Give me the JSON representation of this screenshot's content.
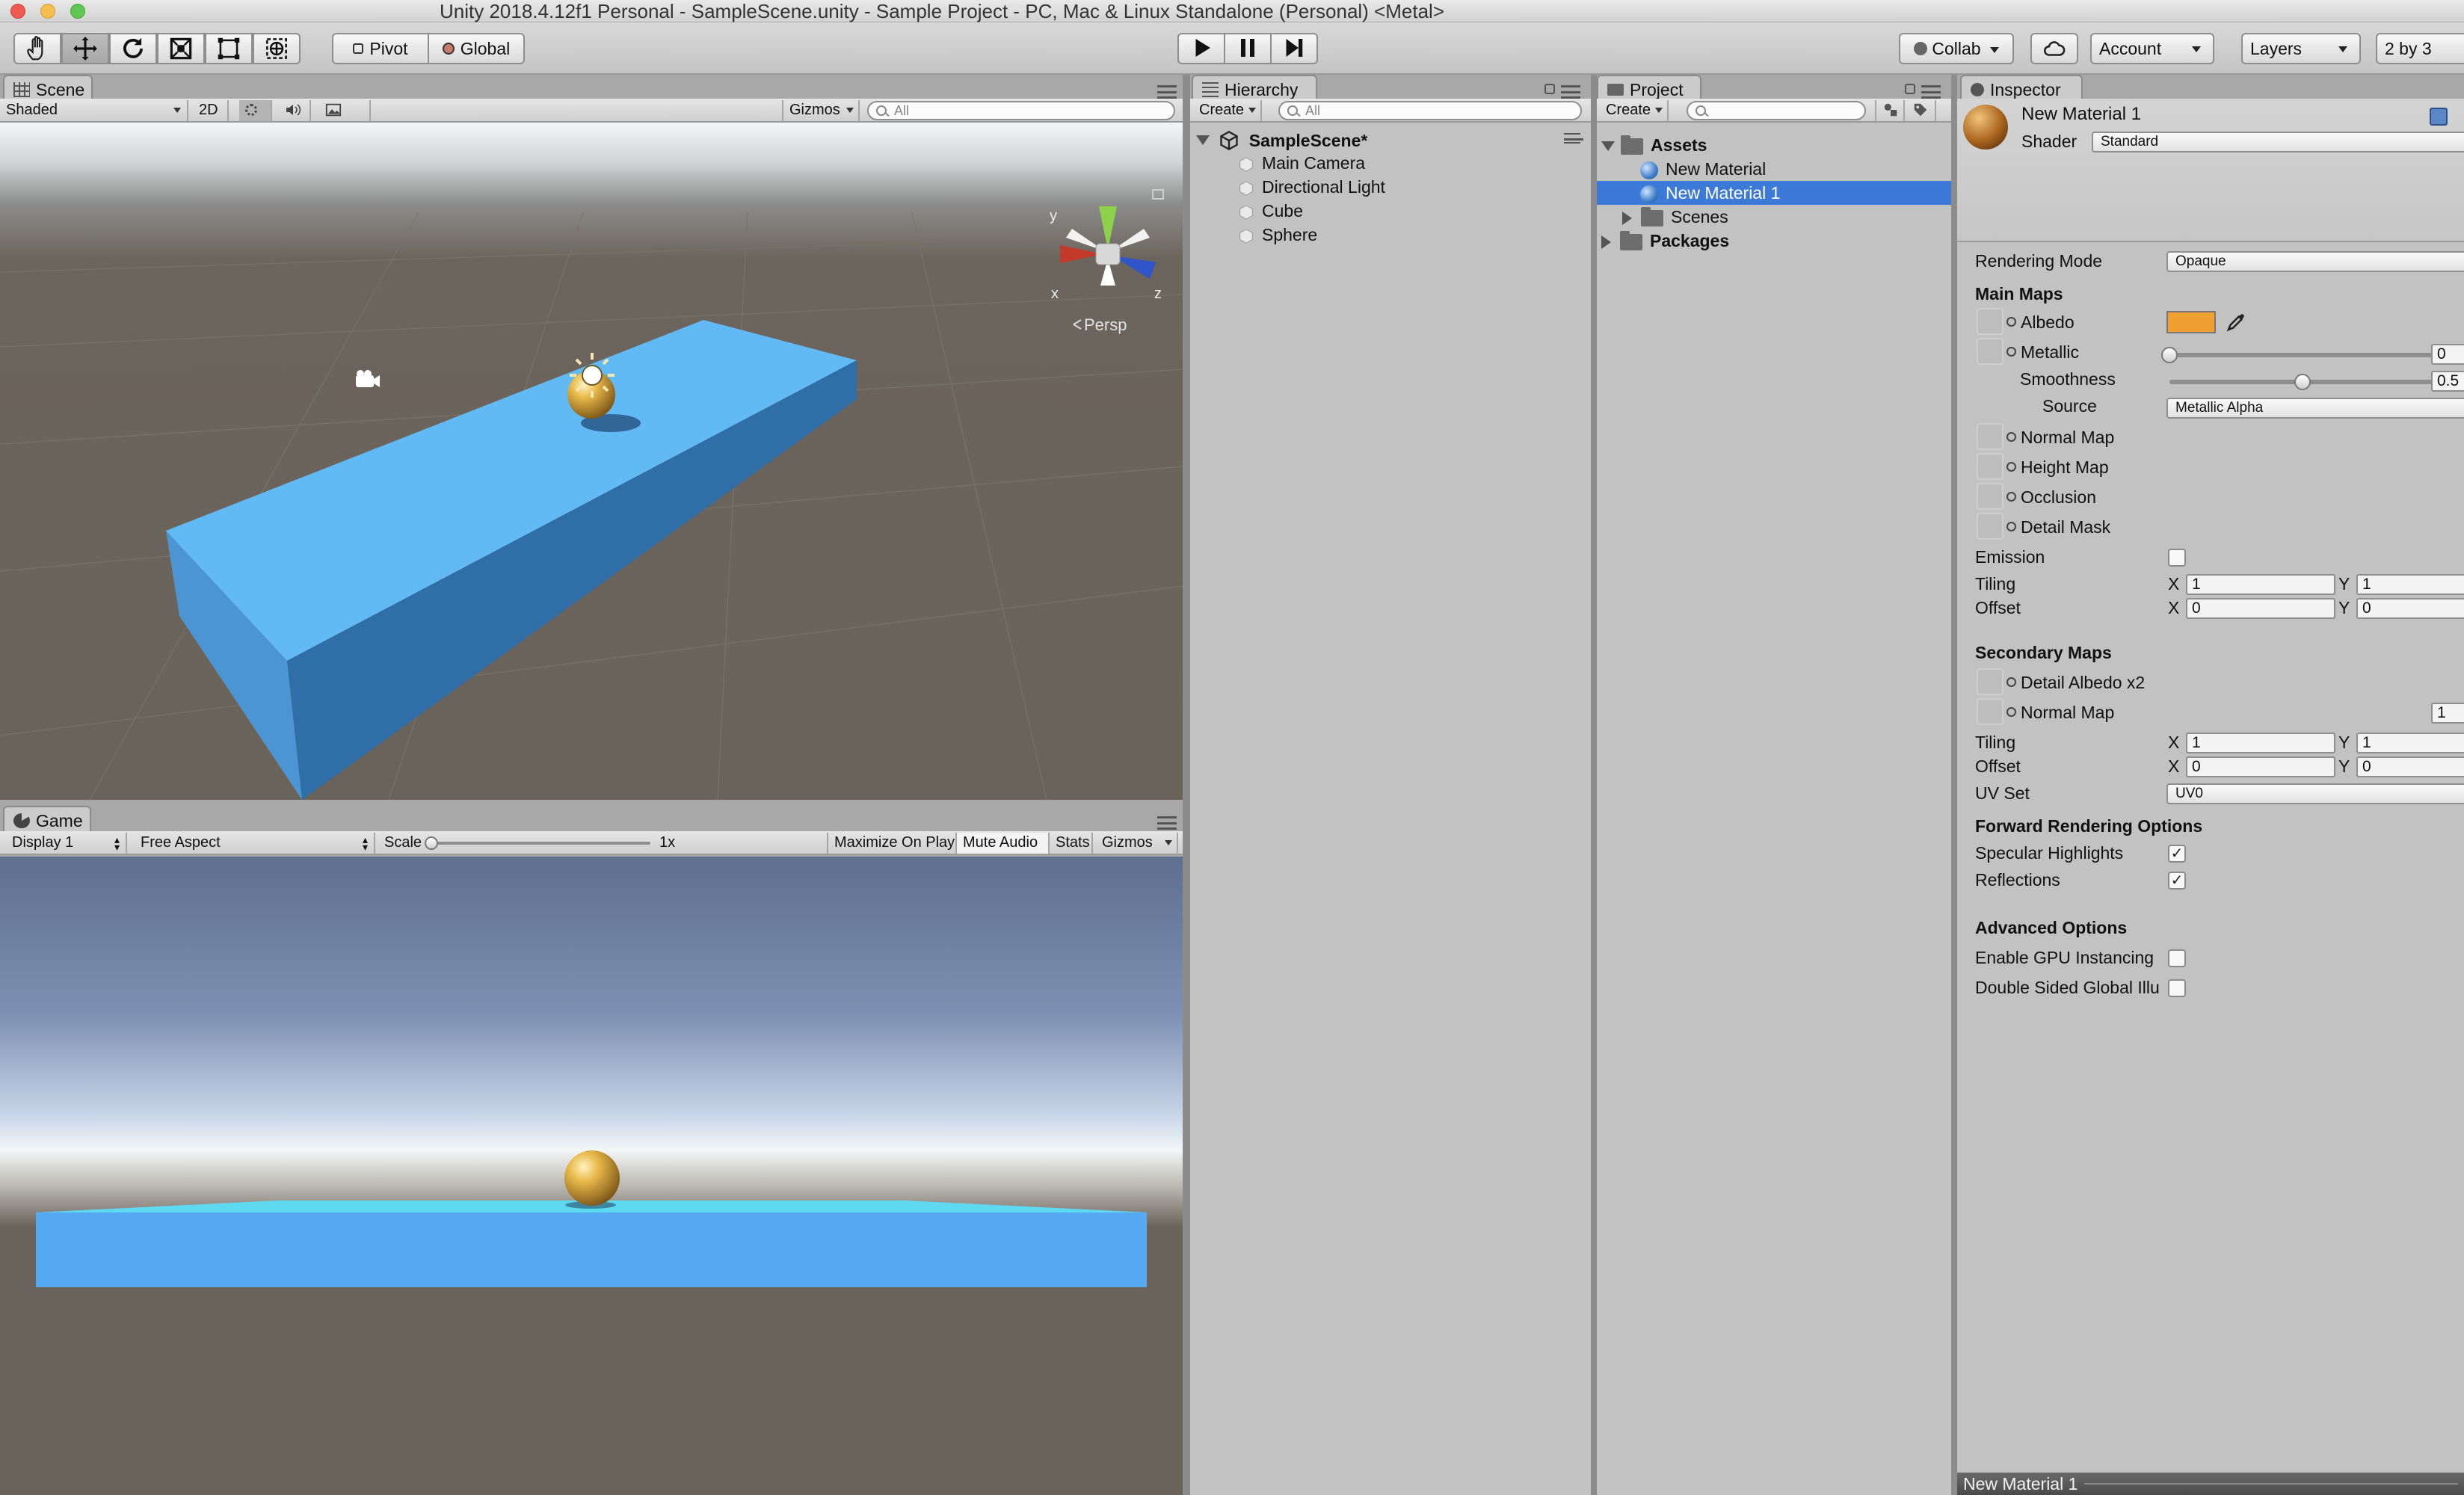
{
  "window": {
    "title": "Unity 2018.4.12f1 Personal - SampleScene.unity - Sample Project - PC, Mac & Linux Standalone (Personal) <Metal>"
  },
  "toolbar": {
    "pivot": "Pivot",
    "global": "Global",
    "collab": "Collab",
    "account": "Account",
    "layers": "Layers",
    "layout": "2 by 3",
    "tools": [
      "hand-tool-icon",
      "move-tool-icon",
      "rotate-tool-icon",
      "scale-tool-icon",
      "rect-tool-icon",
      "transform-tool-icon"
    ]
  },
  "scene": {
    "tab": "Scene",
    "shading": "Shaded",
    "mode2d": "2D",
    "gizmos": "Gizmos",
    "search_placeholder": "All",
    "persp": "Persp",
    "axis_x": "x",
    "axis_y": "y",
    "axis_z": "z"
  },
  "game": {
    "tab": "Game",
    "display": "Display 1",
    "aspect": "Free Aspect",
    "scale_label": "Scale",
    "scale_value": "1x",
    "maximize": "Maximize On Play",
    "mute": "Mute Audio",
    "stats": "Stats",
    "gizmos": "Gizmos"
  },
  "hierarchy": {
    "tab": "Hierarchy",
    "create": "Create",
    "search_placeholder": "All",
    "scene_name": "SampleScene*",
    "items": [
      "Main Camera",
      "Directional Light",
      "Cube",
      "Sphere"
    ]
  },
  "project": {
    "tab": "Project",
    "create": "Create",
    "assets": "Assets",
    "materials": [
      "New Material",
      "New Material 1"
    ],
    "scenes": "Scenes",
    "packages": "Packages"
  },
  "inspector": {
    "tab": "Inspector",
    "material_name": "New Material 1",
    "shader_label": "Shader",
    "shader_value": "Standard",
    "rendering_mode_label": "Rendering Mode",
    "rendering_mode_value": "Opaque",
    "main_maps": "Main Maps",
    "albedo": "Albedo",
    "albedo_color": "#f0a030",
    "metallic": "Metallic",
    "metallic_value": "0",
    "smoothness": "Smoothness",
    "smoothness_value": "0.5",
    "source_label": "Source",
    "source_value": "Metallic Alpha",
    "normal_map": "Normal Map",
    "height_map": "Height Map",
    "occlusion": "Occlusion",
    "detail_mask": "Detail Mask",
    "emission": "Emission",
    "tiling": "Tiling",
    "offset": "Offset",
    "x": "X",
    "y": "Y",
    "tiling_x": "1",
    "tiling_y": "1",
    "offset_x": "0",
    "offset_y": "0",
    "secondary_maps": "Secondary Maps",
    "detail_albedo": "Detail Albedo x2",
    "sec_normal_map": "Normal Map",
    "sec_normal_value": "1",
    "sec_tiling_x": "1",
    "sec_tiling_y": "1",
    "sec_offset_x": "0",
    "sec_offset_y": "0",
    "uv_set_label": "UV Set",
    "uv_set_value": "UV0",
    "forward_rendering": "Forward Rendering Options",
    "specular_highlights": "Specular Highlights",
    "reflections": "Reflections",
    "advanced_options": "Advanced Options",
    "gpu_instancing": "Enable GPU Instancing",
    "double_sided_gi": "Double Sided Global Illu",
    "preview_label": "New Material 1",
    "check_mark": "✓"
  }
}
